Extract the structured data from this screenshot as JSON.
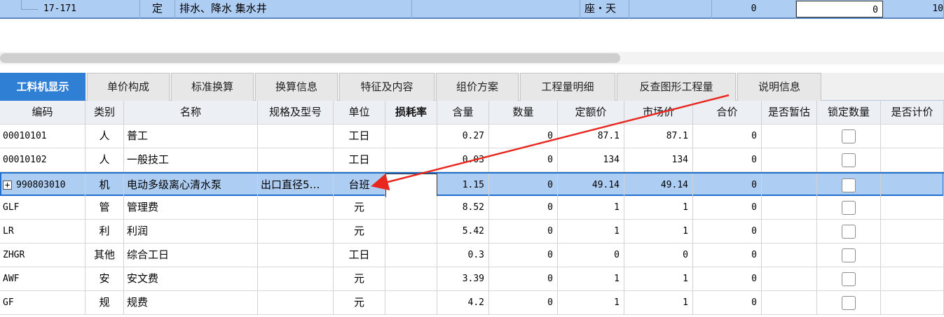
{
  "top_row": {
    "code": "17-171",
    "type": "定",
    "name": "排水、降水 集水井",
    "unit": "座・天",
    "qty1": "0",
    "qty2": "0",
    "qty3": "10"
  },
  "tabs": [
    {
      "label": "工料机显示",
      "active": true
    },
    {
      "label": "单价构成"
    },
    {
      "label": "标准换算"
    },
    {
      "label": "换算信息"
    },
    {
      "label": "特征及内容"
    },
    {
      "label": "组价方案"
    },
    {
      "label": "工程量明细"
    },
    {
      "label": "反查图形工程量"
    },
    {
      "label": "说明信息"
    }
  ],
  "table": {
    "columns": [
      "编码",
      "类别",
      "名称",
      "规格及型号",
      "单位",
      "损耗率",
      "含量",
      "数量",
      "定额价",
      "市场价",
      "合价",
      "是否暂估",
      "锁定数量",
      "是否计价"
    ],
    "rows": [
      {
        "code": "00010101",
        "type": "人",
        "name": "普工",
        "spec": "",
        "unit": "工日",
        "loss": "",
        "content": "0.27",
        "qty": "0",
        "quota": "87.1",
        "market": "87.1",
        "total": "0"
      },
      {
        "code": "00010102",
        "type": "人",
        "name": "一般技工",
        "spec": "",
        "unit": "工日",
        "loss": "",
        "content": "0.03",
        "qty": "0",
        "quota": "134",
        "market": "134",
        "total": "0"
      },
      {
        "code": "990803010",
        "type": "机",
        "name": "电动多级离心清水泵",
        "spec": "出口直径5…",
        "unit": "台班",
        "loss": "",
        "content": "1.15",
        "qty": "0",
        "quota": "49.14",
        "market": "49.14",
        "total": "0",
        "selected": true,
        "expandable": true
      },
      {
        "code": "GLF",
        "type": "管",
        "name": "管理费",
        "spec": "",
        "unit": "元",
        "loss": "",
        "content": "8.52",
        "qty": "0",
        "quota": "1",
        "market": "1",
        "total": "0"
      },
      {
        "code": "LR",
        "type": "利",
        "name": "利润",
        "spec": "",
        "unit": "元",
        "loss": "",
        "content": "5.42",
        "qty": "0",
        "quota": "1",
        "market": "1",
        "total": "0"
      },
      {
        "code": "ZHGR",
        "type": "其他",
        "name": "综合工日",
        "spec": "",
        "unit": "工日",
        "loss": "",
        "content": "0.3",
        "qty": "0",
        "quota": "0",
        "market": "0",
        "total": "0"
      },
      {
        "code": "AWF",
        "type": "安",
        "name": "安文费",
        "spec": "",
        "unit": "元",
        "loss": "",
        "content": "3.39",
        "qty": "0",
        "quota": "1",
        "market": "1",
        "total": "0"
      },
      {
        "code": "GF",
        "type": "规",
        "name": "规费",
        "spec": "",
        "unit": "元",
        "loss": "",
        "content": "4.2",
        "qty": "0",
        "quota": "1",
        "market": "1",
        "total": "0"
      }
    ]
  },
  "colors": {
    "accent": "#2f7fd5",
    "selection": "#aecdf3",
    "annotation_arrow": "#e8281e"
  }
}
